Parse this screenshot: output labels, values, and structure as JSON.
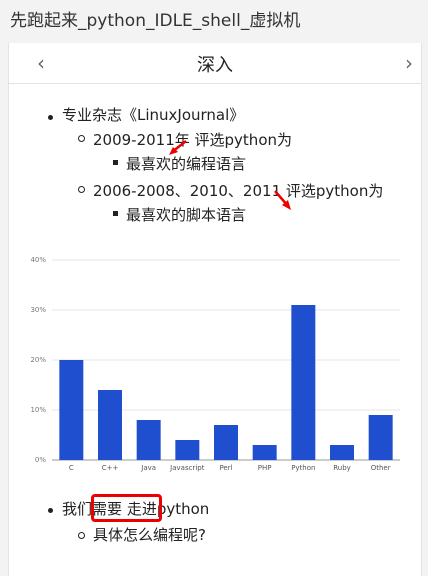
{
  "window": {
    "title": "先跑起来_python_IDLE_shell_虚拟机"
  },
  "nav": {
    "prev_icon": "chevron-left-icon",
    "next_icon": "chevron-right-icon",
    "heading": "深入",
    "prev_glyph": "‹",
    "next_glyph": "›"
  },
  "list": {
    "item1": "专业杂志《LinuxJournal》",
    "sub1": "2009-2011年 评选python为",
    "sub1_detail": "最喜欢的编程语言",
    "sub2": "2006-2008、2010、2011 评选python为",
    "sub2_detail": "最喜欢的脚本语言",
    "item2_parts": [
      "我们",
      "需要",
      " ",
      "走进",
      "python"
    ],
    "item2_sub": "具体怎么编程呢?"
  },
  "chart_data": {
    "type": "bar",
    "categories": [
      "C",
      "C++",
      "Java",
      "Javascript",
      "Perl",
      "PHP",
      "Python",
      "Ruby",
      "Other"
    ],
    "values": [
      20,
      14,
      8,
      4,
      7,
      3,
      31,
      3,
      9
    ],
    "ylim": [
      0,
      40
    ],
    "yticks": [
      "0%",
      "10%",
      "20%",
      "30%",
      "40%"
    ],
    "bar_color": "#1f4fcf",
    "grid": true
  },
  "colors": {
    "highlight": "#e00000",
    "bar": "#1f4fcf"
  }
}
